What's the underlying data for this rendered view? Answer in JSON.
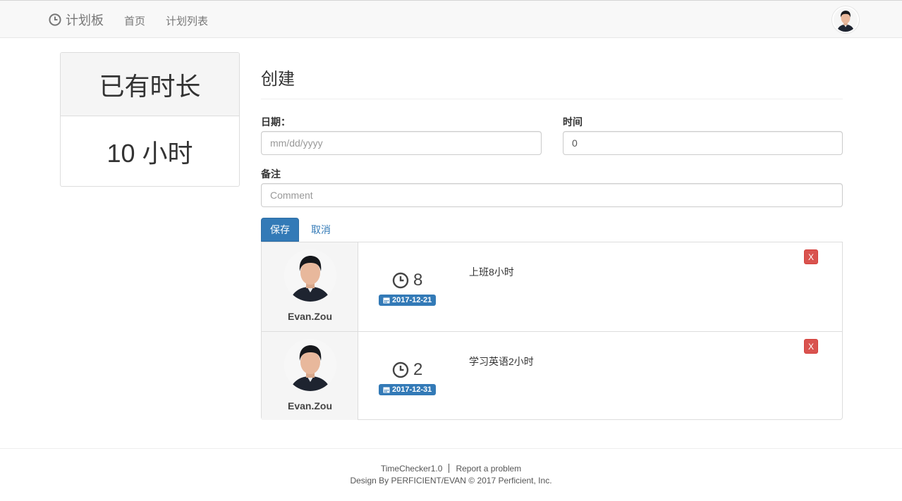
{
  "navbar": {
    "brand_icon": "clock-icon",
    "brand_label": "计划板",
    "nav_items": [
      {
        "label": "首页"
      },
      {
        "label": "计划列表"
      }
    ],
    "avatar_icon": "user-avatar"
  },
  "summary": {
    "heading": "已有时长",
    "value": "10 小时"
  },
  "form": {
    "title": "创建",
    "date_label": "日期：",
    "date_placeholder": "mm/dd/yyyy",
    "time_label": "时间",
    "time_value": "0",
    "comment_label": "备注",
    "comment_placeholder": "Comment",
    "save_label": "保存",
    "cancel_label": "取消"
  },
  "records": [
    {
      "user": "Evan.Zou",
      "hours": "8",
      "date": "2017-12-21",
      "comment": "上班8小时",
      "delete_label": "X"
    },
    {
      "user": "Evan.Zou",
      "hours": "2",
      "date": "2017-12-31",
      "comment": "学习英语2小时",
      "delete_label": "X"
    }
  ],
  "footer": {
    "app_version": "TimeChecker1.0",
    "report_link": "Report a problem",
    "credits": "Design By PERFICIENT/EVAN © 2017 Perficient, Inc."
  },
  "colors": {
    "primary": "#337ab7",
    "danger": "#d9534f",
    "navbar_bg": "#f8f8f8",
    "panel_bg": "#f5f5f5"
  }
}
